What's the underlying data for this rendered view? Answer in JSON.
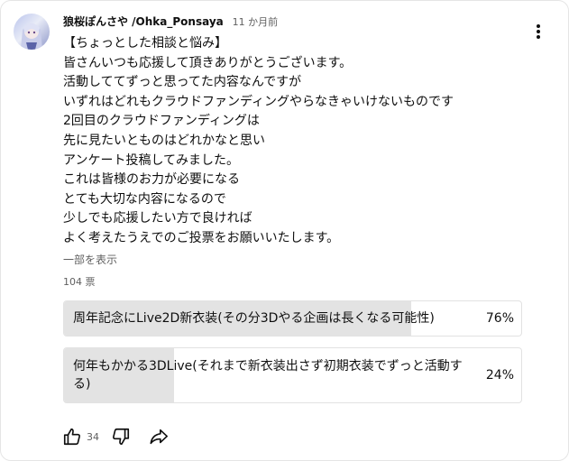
{
  "post": {
    "author": "狼桜ぽんさや /Ohka_Ponsaya",
    "time": "11 か月前",
    "lines": [
      "【ちょっとした相談と悩み】",
      "皆さんいつも応援して頂きありがとうございます。",
      "活動しててずっと思ってた内容なんですが",
      "いずれはどれもクラウドファンディングやらなきゃいけないものです",
      "2回目のクラウドファンディングは",
      "先に見たいとものはどれかなと思い",
      "アンケート投稿してみました。",
      "これは皆様のお力が必要になる",
      "とても大切な内容になるので",
      "少しでも応援したい方で良ければ",
      "よく考えたうえでのご投票をお願いいたします。"
    ],
    "show_more": "一部を表示",
    "votes": "104 票"
  },
  "poll": {
    "options": [
      {
        "text": "周年記念にLive2D新衣装(その分3Dやる企画は長くなる可能性)",
        "percent": "76%",
        "fraction": 0.76
      },
      {
        "text": "何年もかかる3DLive(それまで新衣装出さず初期衣装でずっと活動する)",
        "percent": "24%",
        "fraction": 0.24
      }
    ]
  },
  "actions": {
    "like_count": "34"
  },
  "icons": {
    "menu": "more-vert-icon",
    "like": "thumb-up-icon",
    "dislike": "thumb-down-icon",
    "share": "share-icon"
  }
}
